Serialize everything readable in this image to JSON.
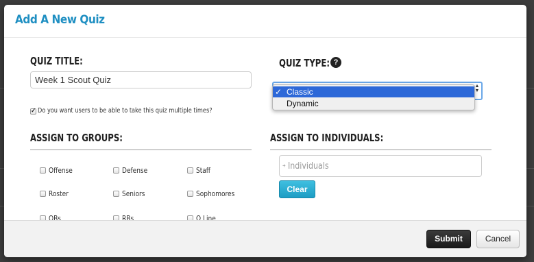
{
  "modal": {
    "title": "Add A New Quiz"
  },
  "quiz_title": {
    "label": "QUIZ TITLE:",
    "value": "Week 1 Scout Quiz"
  },
  "multiple_attempts": {
    "checked": true,
    "label": "Do you want users to be able to take this quiz multiple times?"
  },
  "quiz_type": {
    "label": "QUIZ TYPE:",
    "help_icon": "question-circle-icon",
    "help_glyph": "?",
    "options": [
      {
        "label": "Classic",
        "selected": true,
        "check": "✓"
      },
      {
        "label": "Dynamic",
        "selected": false,
        "check": ""
      }
    ],
    "highlight_color": "#2d68d8"
  },
  "groups": {
    "label": "ASSIGN TO GROUPS:",
    "items": [
      "Offense",
      "Defense",
      "Staff",
      "Roster",
      "Seniors",
      "Sophomores",
      "QBs",
      "RBs",
      "O Line"
    ]
  },
  "individuals": {
    "label": "ASSIGN TO INDIVIDUALS:",
    "placeholder_prefix": "+",
    "placeholder": "Individuals",
    "clear_label": "Clear"
  },
  "footer": {
    "submit_label": "Submit",
    "cancel_label": "Cancel"
  },
  "colors": {
    "accent": "#1f8fc2",
    "clear_button": "#2aaed6",
    "submit_button": "#1a1a1a"
  }
}
